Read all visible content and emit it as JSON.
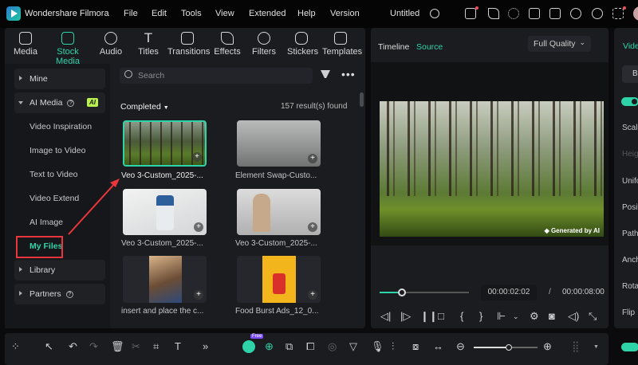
{
  "app": {
    "title": "Wondershare Filmora",
    "project": "Untitled"
  },
  "menu": [
    "File",
    "Edit",
    "Tools",
    "View",
    "Extended",
    "Help",
    "Version"
  ],
  "tabs": [
    {
      "label": "Media"
    },
    {
      "label": "Stock Media"
    },
    {
      "label": "Audio"
    },
    {
      "label": "Titles"
    },
    {
      "label": "Transitions"
    },
    {
      "label": "Effects"
    },
    {
      "label": "Filters"
    },
    {
      "label": "Stickers"
    },
    {
      "label": "Templates"
    }
  ],
  "sidebar": {
    "mine": "Mine",
    "ai_media": "AI Media",
    "ai_badge": "AI",
    "items": [
      "Video Inspiration",
      "Image to Video",
      "Text to Video",
      "Video Extend",
      "AI Image",
      "My Files"
    ],
    "library": "Library",
    "partners": "Partners"
  },
  "browser": {
    "search_placeholder": "Search",
    "filter": "Completed",
    "results": "157 result(s) found",
    "items": [
      {
        "name": "Veo 3-Custom_2025-..."
      },
      {
        "name": "Element Swap-Custo..."
      },
      {
        "name": "Veo 3-Custom_2025-..."
      },
      {
        "name": "Veo 3-Custom_2025-..."
      },
      {
        "name": "insert and place the c..."
      },
      {
        "name": "Food Burst Ads_12_0..."
      }
    ]
  },
  "preview": {
    "tab_timeline": "Timeline",
    "tab_source": "Source",
    "quality": "Full Quality",
    "watermark": "Generated by AI",
    "current_time": "00:00:02:02",
    "separator": "/",
    "total_time": "00:00:08:00",
    "progress": 0.25
  },
  "right_panel": {
    "tab": "Vide",
    "button": "B",
    "labels": [
      "Scale",
      "Heig",
      "Unifo",
      "Posit",
      "Path",
      "Anch",
      "Rota",
      "Flip"
    ]
  },
  "bottom": {
    "free_badge": "Free",
    "zoom": 0.55
  },
  "colors": {
    "accent": "#2fd3a8",
    "annotation": "#e8363c"
  }
}
